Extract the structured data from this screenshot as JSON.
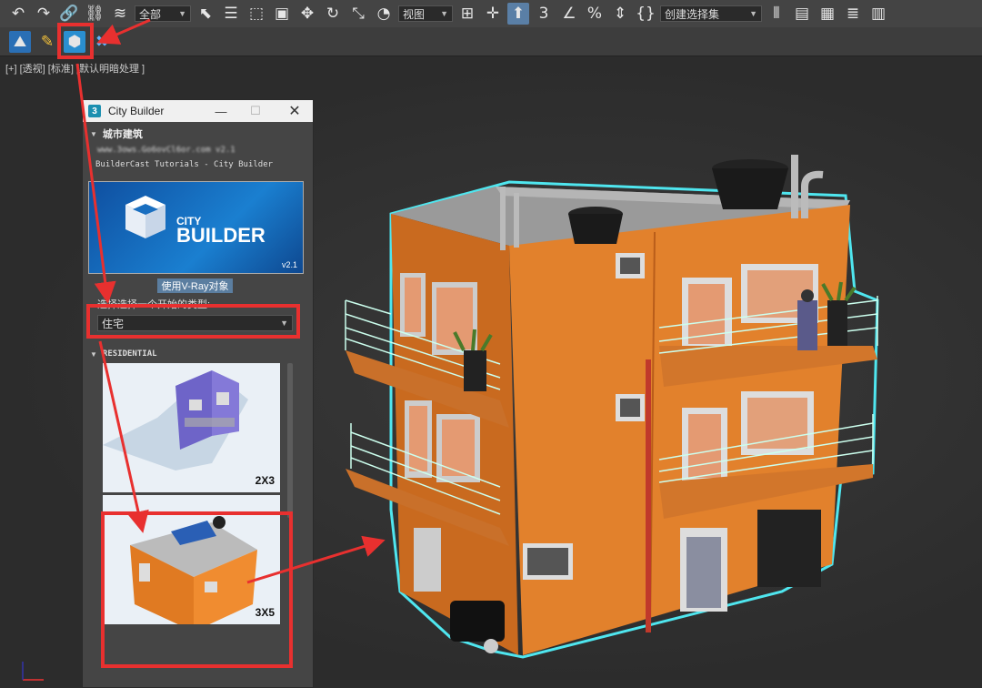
{
  "toolbar": {
    "filter_value": "全部",
    "view_value": "视图",
    "selection_set_placeholder": "创建选择集",
    "snap_label": "3"
  },
  "viewport": {
    "label": "[+] [透视] [标准] [默认明暗处理 ]"
  },
  "city_builder": {
    "window_title": "City Builder",
    "app_icon_text": "3",
    "section_title": "城市建筑",
    "blurred_line": "www.3ows.Go6ovCl6or.com v2.1",
    "credits": "BuilderCast Tutorials - City Builder",
    "banner_title_small": "CITY",
    "banner_title_big": "BUILDER",
    "banner_version": "v2.1",
    "vray_button": "使用V-Ray对象",
    "select_label": "选择选择一个开始的类型:",
    "type_value": "住宅",
    "category_title": "RESIDENTIAL",
    "thumbnails": [
      {
        "label": "2X3"
      },
      {
        "label": "3X5"
      }
    ]
  },
  "colors": {
    "highlight_red": "#e8302f",
    "building_orange": "#e2812c",
    "selection_cyan": "#4fe6ef"
  }
}
